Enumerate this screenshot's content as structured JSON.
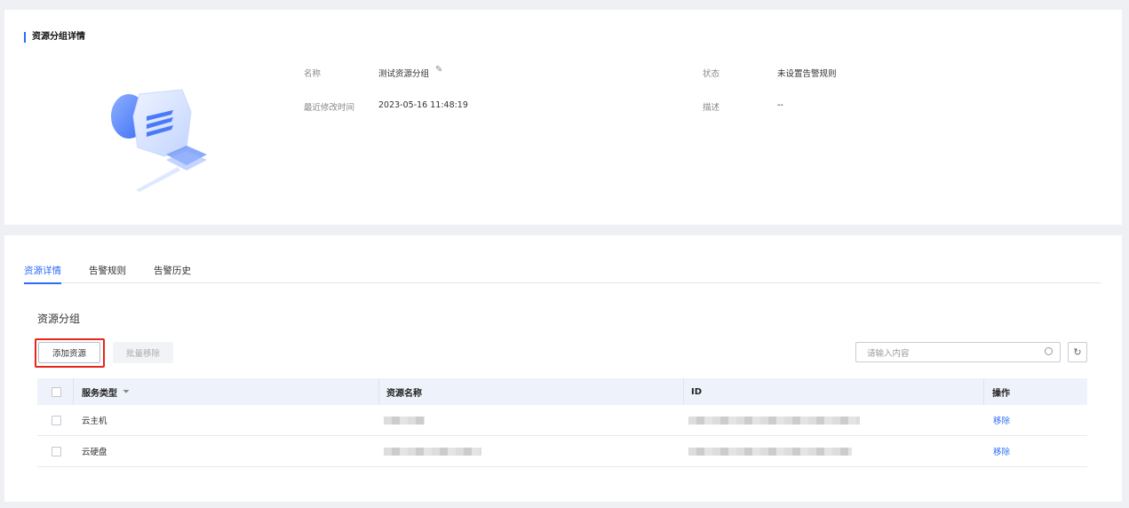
{
  "detail": {
    "title": "资源分组详情",
    "name_label": "名称",
    "name_value": "测试资源分组",
    "modified_label": "最近修改时间",
    "modified_value": "2023-05-16 11:48:19",
    "status_label": "状态",
    "status_value": "未设置告警规则",
    "desc_label": "描述",
    "desc_value": "--"
  },
  "tabs": [
    {
      "label": "资源详情"
    },
    {
      "label": "告警规则"
    },
    {
      "label": "告警历史"
    }
  ],
  "section_title": "资源分组",
  "toolbar": {
    "add_label": "添加资源",
    "batch_remove_label": "批量移除",
    "search_placeholder": "请输入内容"
  },
  "table": {
    "headers": [
      "服务类型",
      "资源名称",
      "ID",
      "操作"
    ],
    "rows": [
      {
        "type": "云主机",
        "action": "移除"
      },
      {
        "type": "云硬盘",
        "action": "移除"
      }
    ]
  },
  "colors": {
    "accent": "#2d6cf6",
    "highlight": "#e8261c"
  }
}
